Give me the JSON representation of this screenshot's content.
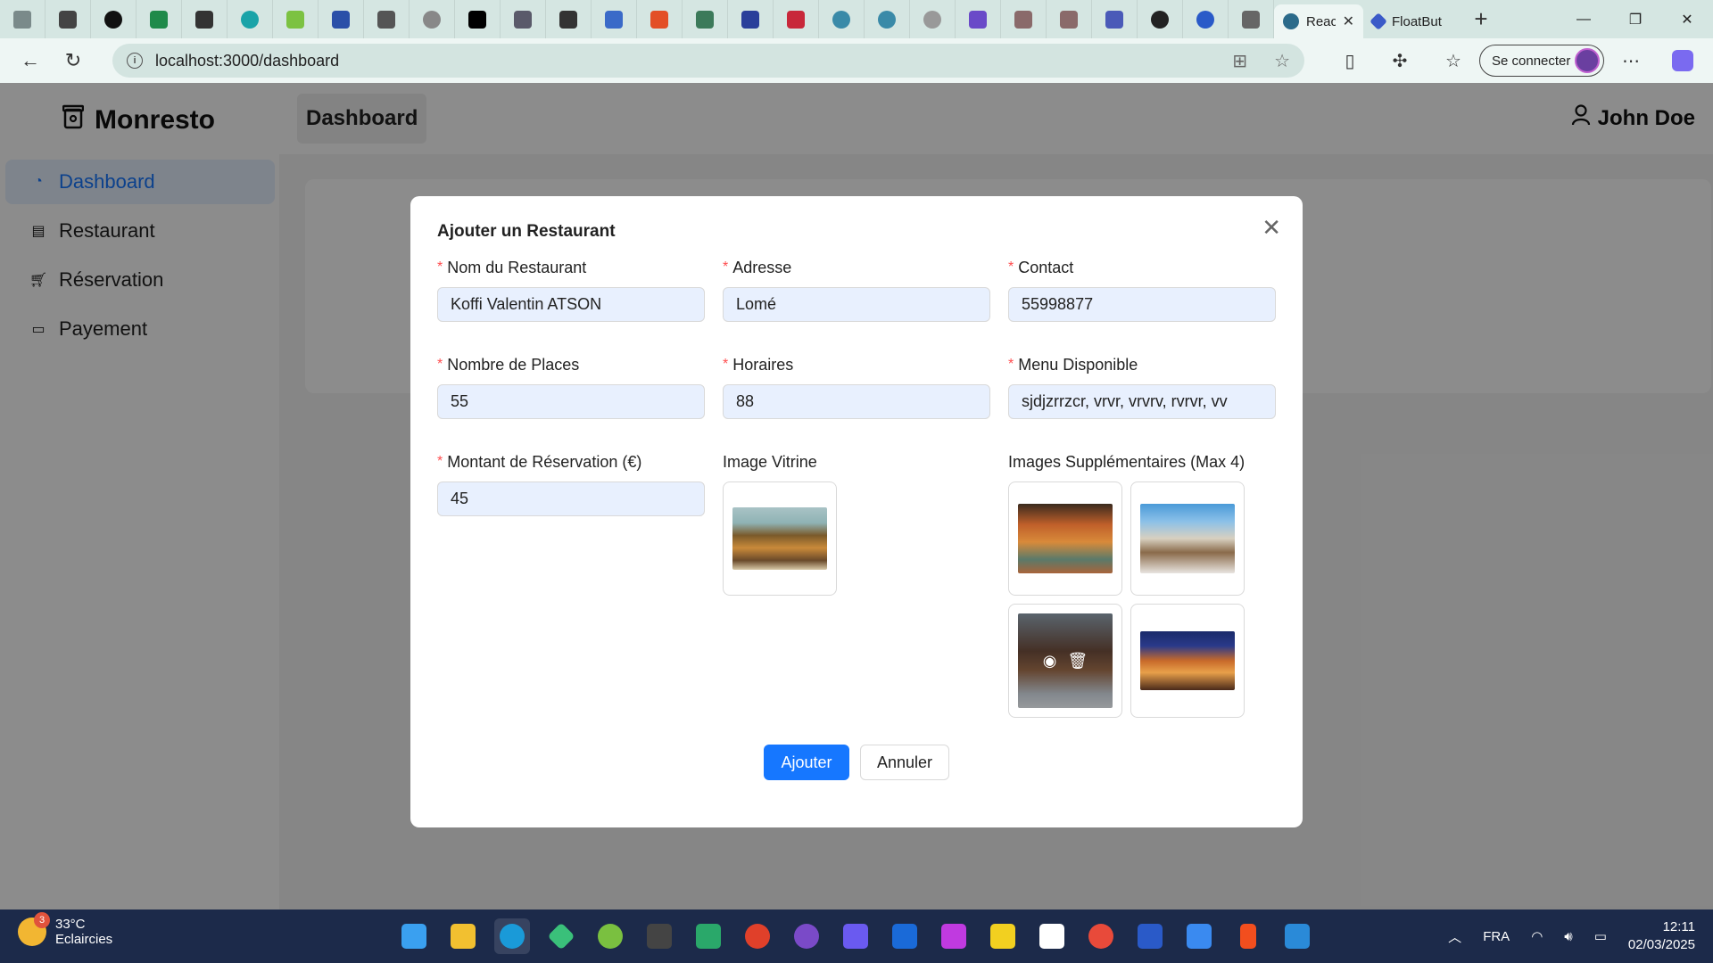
{
  "browser": {
    "tabs": [
      {
        "title": "Reac"
      },
      {
        "title": "FloatBut"
      }
    ],
    "url": "localhost:3000/dashboard",
    "signin_label": "Se connecter"
  },
  "app": {
    "brand": "Monresto",
    "menu": [
      {
        "label": "Dashboard",
        "icon": "dashboard-icon",
        "active": true
      },
      {
        "label": "Restaurant",
        "icon": "restaurant-icon"
      },
      {
        "label": "Réservation",
        "icon": "cart-icon"
      },
      {
        "label": "Payement",
        "icon": "credit-card-icon"
      }
    ],
    "header_title": "Dashboard",
    "user_name": "John Doe"
  },
  "modal": {
    "title": "Ajouter un Restaurant",
    "fields": {
      "nom": {
        "label": "Nom du Restaurant",
        "value": "Koffi Valentin ATSON"
      },
      "adresse": {
        "label": "Adresse",
        "value": "Lomé"
      },
      "contact": {
        "label": "Contact",
        "value": "55998877"
      },
      "places": {
        "label": "Nombre de Places",
        "value": "55"
      },
      "horaires": {
        "label": "Horaires",
        "value": "88"
      },
      "menu": {
        "label": "Menu Disponible",
        "value": "sjdjzrrzcr, vrvr, vrvrv, rvrvr, vv"
      },
      "montant": {
        "label": "Montant de Réservation (€)",
        "value": "45"
      }
    },
    "image_vitrine_label": "Image Vitrine",
    "images_supp_label": "Images Supplémentaires (Max 4)",
    "submit_label": "Ajouter",
    "cancel_label": "Annuler"
  },
  "taskbar": {
    "weather_temp": "33°C",
    "weather_desc": "Eclaircies",
    "weather_badge": "3",
    "lang": "FRA",
    "time": "12:11",
    "date": "02/03/2025"
  },
  "colors": {
    "primary": "#1677ff",
    "required": "#ff4d4f",
    "taskbar": "#1c2a4a",
    "input_bg": "#e8f0fe"
  }
}
